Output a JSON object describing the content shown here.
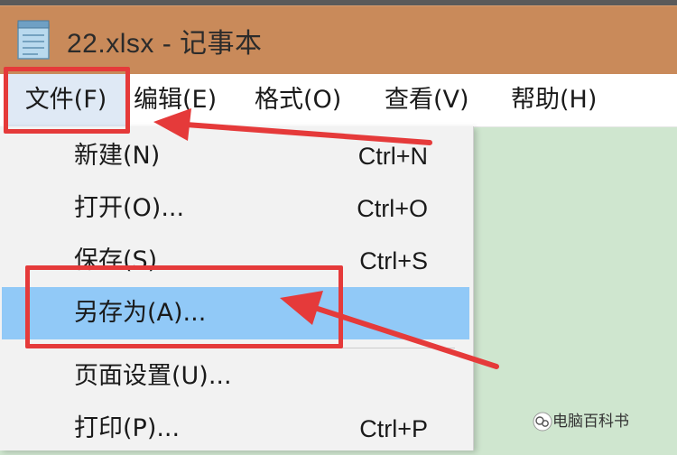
{
  "window": {
    "title": "22.xlsx - 记事本",
    "icon": "notepad-icon"
  },
  "menubar": {
    "items": [
      {
        "label": "文件(F)"
      },
      {
        "label": "编辑(E)"
      },
      {
        "label": "格式(O)"
      },
      {
        "label": "查看(V)"
      },
      {
        "label": "帮助(H)"
      }
    ]
  },
  "file_menu": {
    "items": [
      {
        "label": "新建(N)",
        "shortcut": "Ctrl+N"
      },
      {
        "label": "打开(O)...",
        "shortcut": "Ctrl+O"
      },
      {
        "label": "保存(S)",
        "shortcut": "Ctrl+S"
      },
      {
        "label": "另存为(A)...",
        "shortcut": ""
      },
      {
        "label": "页面设置(U)...",
        "shortcut": ""
      },
      {
        "label": "打印(P)...",
        "shortcut": "Ctrl+P"
      }
    ]
  },
  "annotation": {
    "highlight_color": "#e53a3a"
  },
  "watermark": {
    "text": "电脑百科书",
    "icon": "wechat-icon"
  },
  "colors": {
    "titlebar": "#c98a5a",
    "selection": "#91c9f7",
    "editor_bg": "#cfe6cf"
  }
}
